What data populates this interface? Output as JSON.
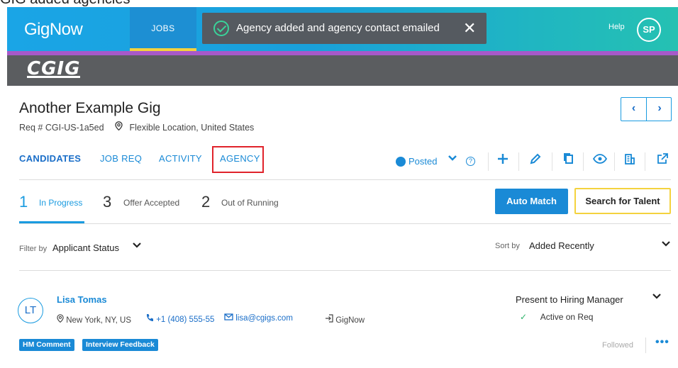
{
  "caption": "GIG added agencies",
  "header": {
    "logo": "GigNow",
    "nav_jobs": "JOBS",
    "help": "Help",
    "user_initials": "SP"
  },
  "toast": {
    "message": "Agency added and agency contact emailed",
    "close": "✕"
  },
  "brand_band": {
    "logo": "CGIG"
  },
  "gig": {
    "title": "Another Example Gig",
    "req_label": "Req #",
    "req_id": "CGI-US-1a5ed",
    "location": "Flexible Location, United States"
  },
  "tabs": [
    {
      "label": "CANDIDATES",
      "active": true
    },
    {
      "label": "JOB REQ",
      "active": false
    },
    {
      "label": "ACTIVITY",
      "active": false
    },
    {
      "label": "AGENCY",
      "active": false
    }
  ],
  "status": {
    "label": "Posted"
  },
  "pipeline": [
    {
      "count": "1",
      "label": "In Progress",
      "active": true
    },
    {
      "count": "3",
      "label": "Offer Accepted",
      "active": false
    },
    {
      "count": "2",
      "label": "Out of Running",
      "active": false
    }
  ],
  "buttons": {
    "auto_match": "Auto Match",
    "search_talent": "Search for Talent"
  },
  "filter": {
    "label": "Filter by",
    "value": "Applicant Status"
  },
  "sort": {
    "label": "Sort by",
    "value": "Added Recently"
  },
  "candidate": {
    "initials": "LT",
    "name": "Lisa Tomas",
    "location": "New York, NY, US",
    "phone": "+1 (408) 555-55",
    "email": "lisa@cgigs.com",
    "source": "GigNow",
    "stage": "Present to Hiring Manager",
    "req_status": "Active on Req",
    "tags": [
      "HM Comment",
      "Interview Feedback"
    ],
    "followed": "Followed"
  },
  "colors": {
    "accent": "#1a8ad6",
    "header_purple": "#a759c9",
    "band_gray": "#5b5d60",
    "highlight_red": "#e0232b",
    "search_yellow": "#f4d23e"
  }
}
